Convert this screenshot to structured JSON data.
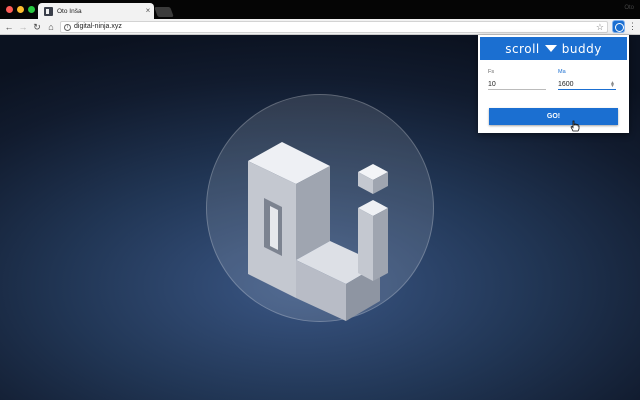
{
  "tab": {
    "title": "Oto Inša",
    "close": "×"
  },
  "window": {
    "profile_name": "Oto"
  },
  "toolbar": {
    "back": "←",
    "forward": "→",
    "reload": "↻",
    "home": "⌂",
    "info": "i",
    "star": "☆",
    "menu": "⋮"
  },
  "omnibox": {
    "url": "digital-ninja.xyz"
  },
  "popup": {
    "brand_left": "scroll",
    "brand_right": "buddy",
    "fps_label": "Fs",
    "fps_value": "10",
    "max_label": "Ma",
    "max_value": "1600",
    "go_label": "GO!"
  },
  "icons": [
    "close-icon",
    "back-icon",
    "forward-icon",
    "reload-icon",
    "home-icon",
    "info-icon",
    "star-icon",
    "extension-icon",
    "menu-icon",
    "arrow-down-icon",
    "spinner-icon",
    "hand-cursor-icon"
  ],
  "colors": {
    "accent": "#1b6fd1",
    "titlebar": "#050505",
    "toolbar": "#f2f2f2",
    "background_dark": "#0b1220",
    "background_glow": "#3a5684"
  }
}
